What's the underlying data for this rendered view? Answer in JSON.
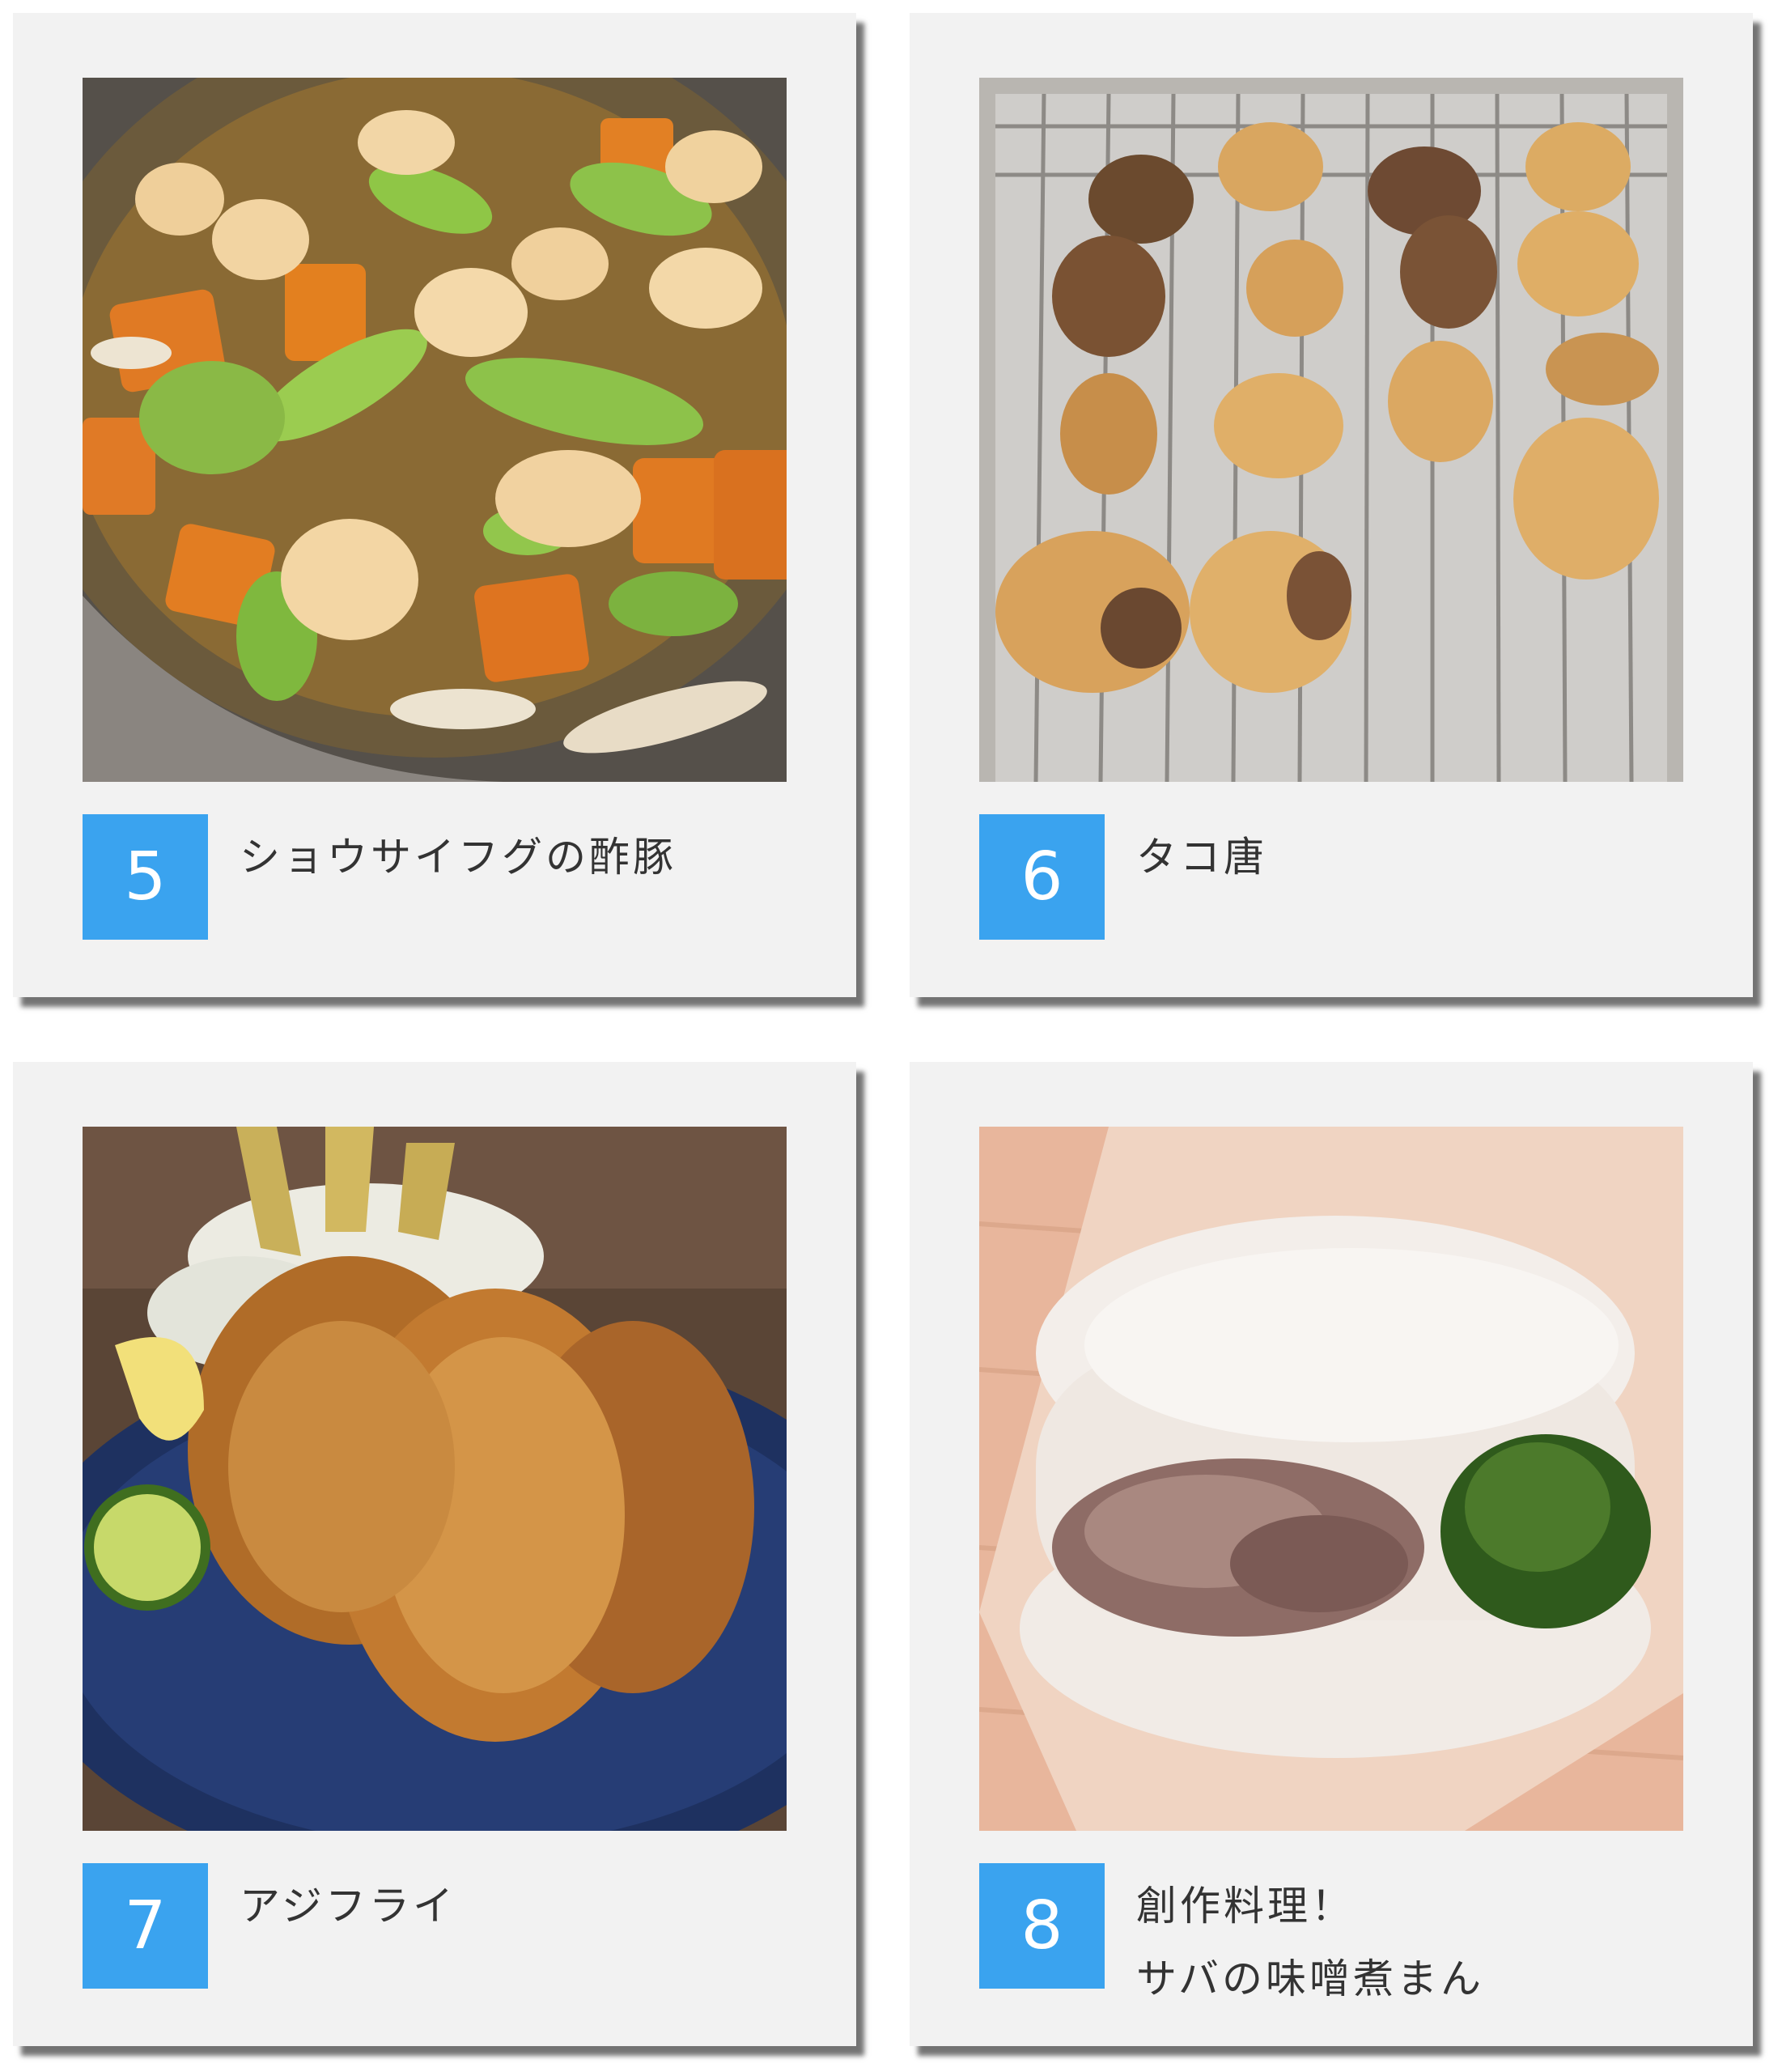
{
  "cards": [
    {
      "number": "5",
      "lines": [
        "ショウサイフグの酢豚"
      ],
      "photo": "sweet-and-sour-pufferfish-with-vegetables"
    },
    {
      "number": "6",
      "lines": [
        "タコ唐"
      ],
      "photo": "fried-octopus-on-wire-rack"
    },
    {
      "number": "7",
      "lines": [
        "アジフライ"
      ],
      "photo": "fried-horse-mackerel-plate"
    },
    {
      "number": "8",
      "lines": [
        "創作料理！",
        "サバの味噌煮まん"
      ],
      "photo": "mackerel-miso-steamed-bun"
    }
  ],
  "colors": {
    "badge": "#3aa3ef",
    "card": "#f2f2f2",
    "caption_text": "#333333"
  }
}
